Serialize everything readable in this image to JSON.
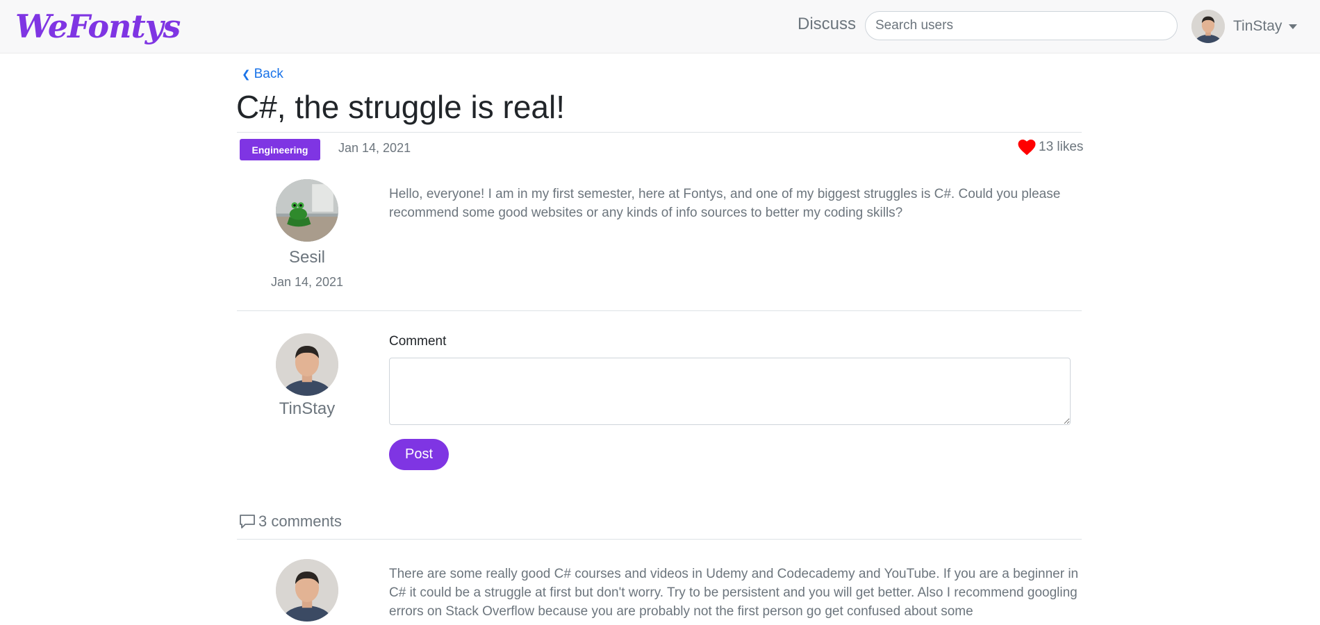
{
  "navbar": {
    "logo": "WeFontys",
    "discuss_label": "Discuss",
    "search_placeholder": "Search users",
    "user_name": "TinStay"
  },
  "post": {
    "back_label": "Back",
    "title": "C#, the struggle is real!",
    "tag": "Engineering",
    "date": "Jan 14, 2021",
    "likes": "13 likes",
    "author": {
      "name": "Sesil",
      "date": "Jan 14, 2021"
    },
    "body": "Hello, everyone! I am in my first semester, here at Fontys, and one of my biggest struggles is C#. Could you please recommend some good websites or any kinds of info sources to better my coding skills?"
  },
  "comment_form": {
    "user_name": "TinStay",
    "label": "Comment",
    "post_button": "Post"
  },
  "comments": {
    "count_label": "3 comments",
    "items": [
      {
        "text": "There are some really good C# courses and videos in Udemy and Codecademy and YouTube. If you are a beginner in C# it could be a struggle at first but don't worry. Try to be persistent and you will get better. Also I recommend googling errors on Stack Overflow because you are probably not the first person go get confused about some"
      }
    ]
  },
  "colors": {
    "brand": "#7f35e3",
    "link": "#1a73e8",
    "heart": "#ff0000",
    "muted_text": "#6c757d"
  },
  "icons": [
    "chevron-left-icon",
    "heart-icon",
    "comment-icon",
    "caret-down-icon"
  ]
}
